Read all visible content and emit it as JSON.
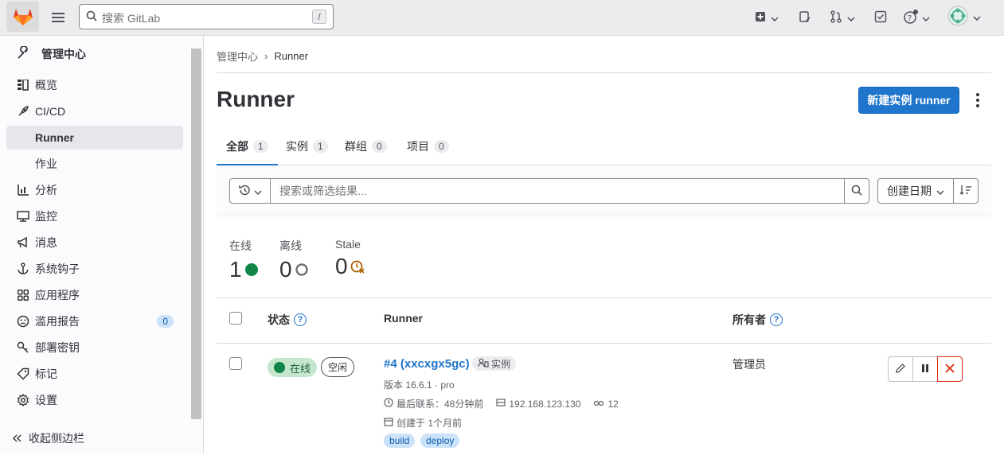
{
  "topbar": {
    "search_placeholder": "搜索 GitLab",
    "search_shortcut": "/"
  },
  "sidebar": {
    "header": "管理中心",
    "items": [
      {
        "label": "概览"
      },
      {
        "label": "CI/CD"
      },
      {
        "label": "Runner"
      },
      {
        "label": "作业"
      },
      {
        "label": "分析"
      },
      {
        "label": "监控"
      },
      {
        "label": "消息"
      },
      {
        "label": "系统钩子"
      },
      {
        "label": "应用程序"
      },
      {
        "label": "滥用报告",
        "count": "0"
      },
      {
        "label": "部署密钥"
      },
      {
        "label": "标记"
      },
      {
        "label": "设置"
      }
    ],
    "collapse_label": "收起侧边栏"
  },
  "breadcrumb": {
    "parent": "管理中心",
    "separator": "›",
    "current": "Runner"
  },
  "page": {
    "title": "Runner",
    "new_button": "新建实例 runner"
  },
  "tabs": [
    {
      "label": "全部",
      "count": "1"
    },
    {
      "label": "实例",
      "count": "1"
    },
    {
      "label": "群组",
      "count": "0"
    },
    {
      "label": "项目",
      "count": "0"
    }
  ],
  "filter": {
    "placeholder": "搜索或筛选结果...",
    "sort_label": "创建日期"
  },
  "stats": [
    {
      "label": "在线",
      "value": "1"
    },
    {
      "label": "离线",
      "value": "0"
    },
    {
      "label": "Stale",
      "value": "0"
    }
  ],
  "table": {
    "headers": {
      "status": "状态",
      "runner": "Runner",
      "owner": "所有者"
    },
    "rows": [
      {
        "status_online": "在线",
        "status_idle": "空闲",
        "name": "#4 (xxcxgx5gc)",
        "type": "实例",
        "version": "版本 16.6.1 · pro",
        "last_contact": "最后联系：48分钟前",
        "ip": "192.168.123.130",
        "jobs": "12",
        "created": "创建于 1个月前",
        "tags": [
          "build",
          "deploy"
        ],
        "owner": "管理员"
      }
    ]
  },
  "colors": {
    "primary": "#1f75cb",
    "online": "#108548",
    "danger": "#dd2b0e"
  }
}
